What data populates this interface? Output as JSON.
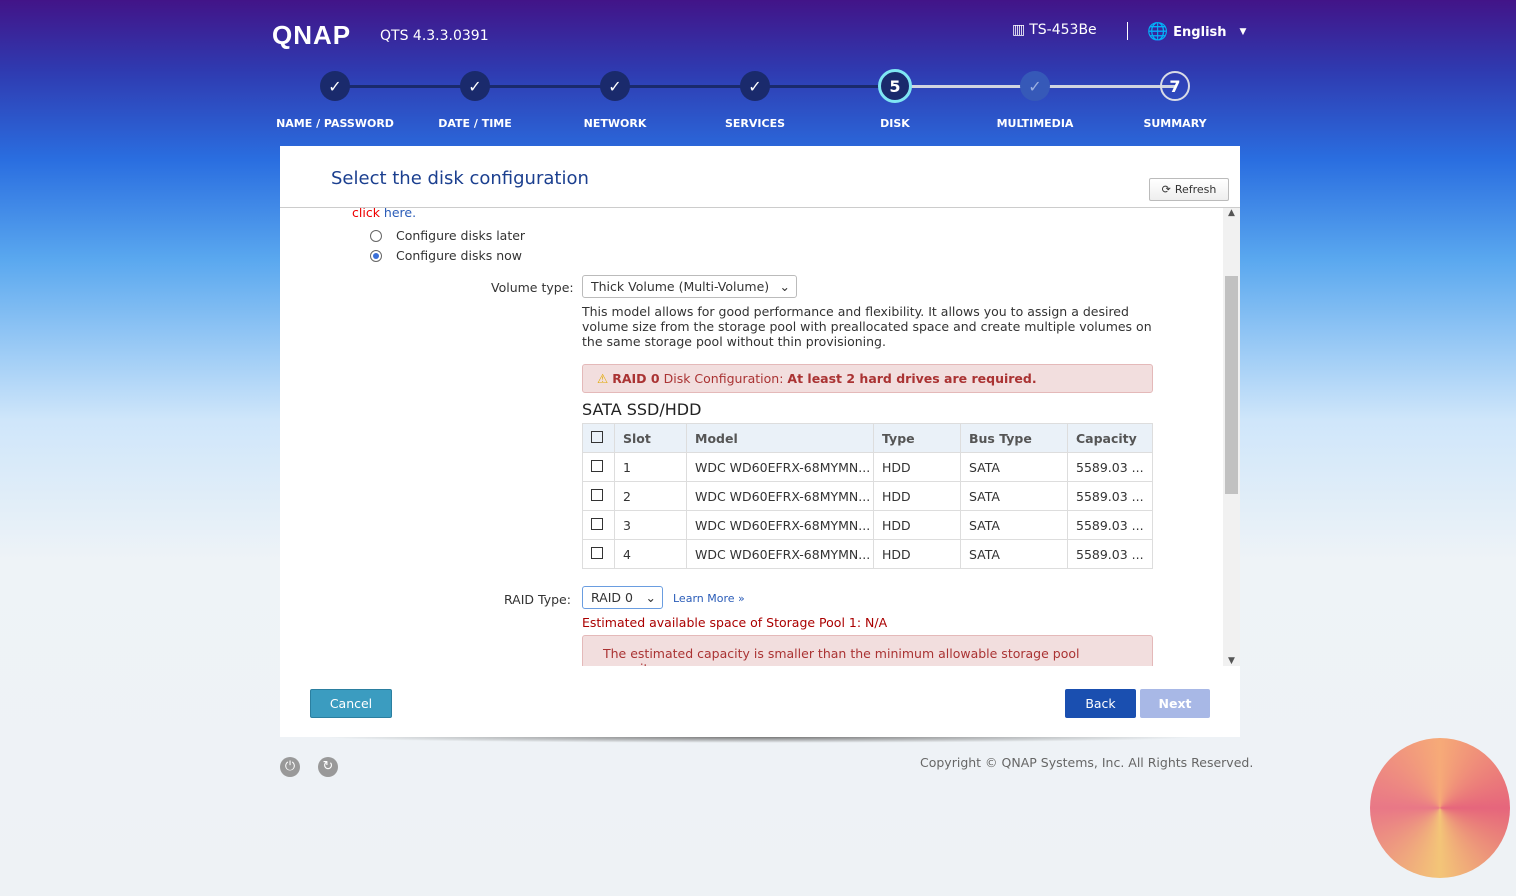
{
  "header": {
    "logo": "QNAP",
    "version": "QTS 4.3.3.0391",
    "model": "TS-453Be",
    "language": "English"
  },
  "steps": [
    {
      "label": "NAME / PASSWORD",
      "state": "done",
      "mark": "✓"
    },
    {
      "label": "DATE / TIME",
      "state": "done",
      "mark": "✓"
    },
    {
      "label": "NETWORK",
      "state": "done",
      "mark": "✓"
    },
    {
      "label": "SERVICES",
      "state": "done",
      "mark": "✓"
    },
    {
      "label": "DISK",
      "state": "current",
      "mark": "5"
    },
    {
      "label": "MULTIMEDIA",
      "state": "disabled",
      "mark": "✓"
    },
    {
      "label": "SUMMARY",
      "state": "future",
      "mark": "7"
    }
  ],
  "panel": {
    "title": "Select the disk configuration",
    "refresh": "Refresh",
    "click": "click",
    "here": "here.",
    "option_later": "Configure disks later",
    "option_now": "Configure disks now",
    "selected_option": "now",
    "volume_label": "Volume type:",
    "volume_value": "Thick Volume (Multi-Volume)",
    "volume_desc": "This model allows for good performance and flexibility. It allows you to assign a desired volume size from the storage pool with preallocated space and create multiple volumes on the same storage pool without thin provisioning.",
    "warn_raid": "RAID 0",
    "warn_mid": "Disk Configuration:",
    "warn_end": "At least 2 hard drives are required.",
    "section": "SATA SSD/HDD",
    "columns": [
      "Slot",
      "Model",
      "Type",
      "Bus Type",
      "Capacity"
    ],
    "rows": [
      [
        "1",
        "WDC WD60EFRX-68MYMN...",
        "HDD",
        "SATA",
        "5589.03 ..."
      ],
      [
        "2",
        "WDC WD60EFRX-68MYMN...",
        "HDD",
        "SATA",
        "5589.03 ..."
      ],
      [
        "3",
        "WDC WD60EFRX-68MYMN...",
        "HDD",
        "SATA",
        "5589.03 ..."
      ],
      [
        "4",
        "WDC WD60EFRX-68MYMN...",
        "HDD",
        "SATA",
        "5589.03 ..."
      ]
    ],
    "raid_label": "RAID Type:",
    "raid_value": "RAID 0",
    "learn_more": "Learn More »",
    "estimate": "Estimated available space of Storage Pool 1: N/A",
    "estimate_warn": "The estimated capacity is smaller than the minimum allowable storage pool capacity",
    "cancel": "Cancel",
    "back": "Back",
    "next": "Next"
  },
  "footer": {
    "copyright": "Copyright © QNAP Systems, Inc. All Rights Reserved."
  }
}
